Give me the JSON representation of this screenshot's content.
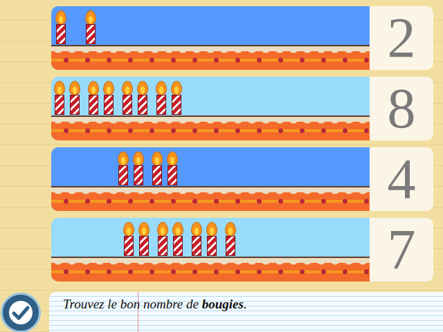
{
  "cakes": [
    {
      "number": "2",
      "candles": 2,
      "color": "#5599ff"
    },
    {
      "number": "8",
      "candles": 8,
      "color": "#99dbfa"
    },
    {
      "number": "4",
      "candles": 4,
      "color": "#5599ff"
    },
    {
      "number": "7",
      "candles": 7,
      "color": "#99dbfa"
    }
  ],
  "instruction": {
    "before": "Trouvez le bon nombre de ",
    "bold": "bougies",
    "after": "."
  }
}
